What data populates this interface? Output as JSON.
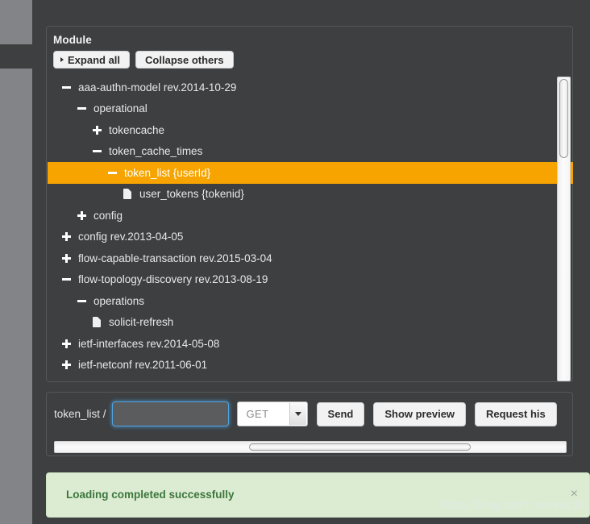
{
  "module_panel": {
    "title": "Module",
    "buttons": {
      "expand_all": "Expand all",
      "collapse_others": "Collapse others"
    },
    "tree": [
      {
        "label": "aaa-authn-model rev.2014-10-29",
        "depth": 0,
        "icon": "minus-icon",
        "selected": false
      },
      {
        "label": "operational",
        "depth": 1,
        "icon": "minus-icon",
        "selected": false
      },
      {
        "label": "tokencache",
        "depth": 2,
        "icon": "plus-icon",
        "selected": false
      },
      {
        "label": "token_cache_times",
        "depth": 2,
        "icon": "minus-icon",
        "selected": false
      },
      {
        "label": "token_list {userId}",
        "depth": 3,
        "icon": "minus-icon",
        "selected": true
      },
      {
        "label": "user_tokens {tokenid}",
        "depth": 4,
        "icon": "file-icon",
        "selected": false
      },
      {
        "label": "config",
        "depth": 1,
        "icon": "plus-icon",
        "selected": false
      },
      {
        "label": "config rev.2013-04-05",
        "depth": 0,
        "icon": "plus-icon",
        "selected": false
      },
      {
        "label": "flow-capable-transaction rev.2015-03-04",
        "depth": 0,
        "icon": "plus-icon",
        "selected": false
      },
      {
        "label": "flow-topology-discovery rev.2013-08-19",
        "depth": 0,
        "icon": "minus-icon",
        "selected": false
      },
      {
        "label": "operations",
        "depth": 1,
        "icon": "minus-icon",
        "selected": false
      },
      {
        "label": "solicit-refresh",
        "depth": 2,
        "icon": "file-icon",
        "selected": false
      },
      {
        "label": "ietf-interfaces rev.2014-05-08",
        "depth": 0,
        "icon": "plus-icon",
        "selected": false
      },
      {
        "label": "ietf-netconf rev.2011-06-01",
        "depth": 0,
        "icon": "plus-icon",
        "selected": false
      }
    ]
  },
  "request_panel": {
    "path_prefix": "token_list /",
    "path_value": "",
    "path_placeholder": "",
    "method": "GET",
    "buttons": {
      "send": "Send",
      "show_preview": "Show preview",
      "request_history": "Request his"
    }
  },
  "alert": {
    "message": "Loading completed successfully",
    "close_label": "×"
  },
  "watermark": "https://blog.csdn.net/iroy38",
  "colors": {
    "page_background": "#3d3f41",
    "rail": "#828487",
    "selection": "#f7a400",
    "alert_background": "#dcecd2",
    "alert_text": "#3c763d",
    "focus_ring": "#4ea3e0"
  }
}
